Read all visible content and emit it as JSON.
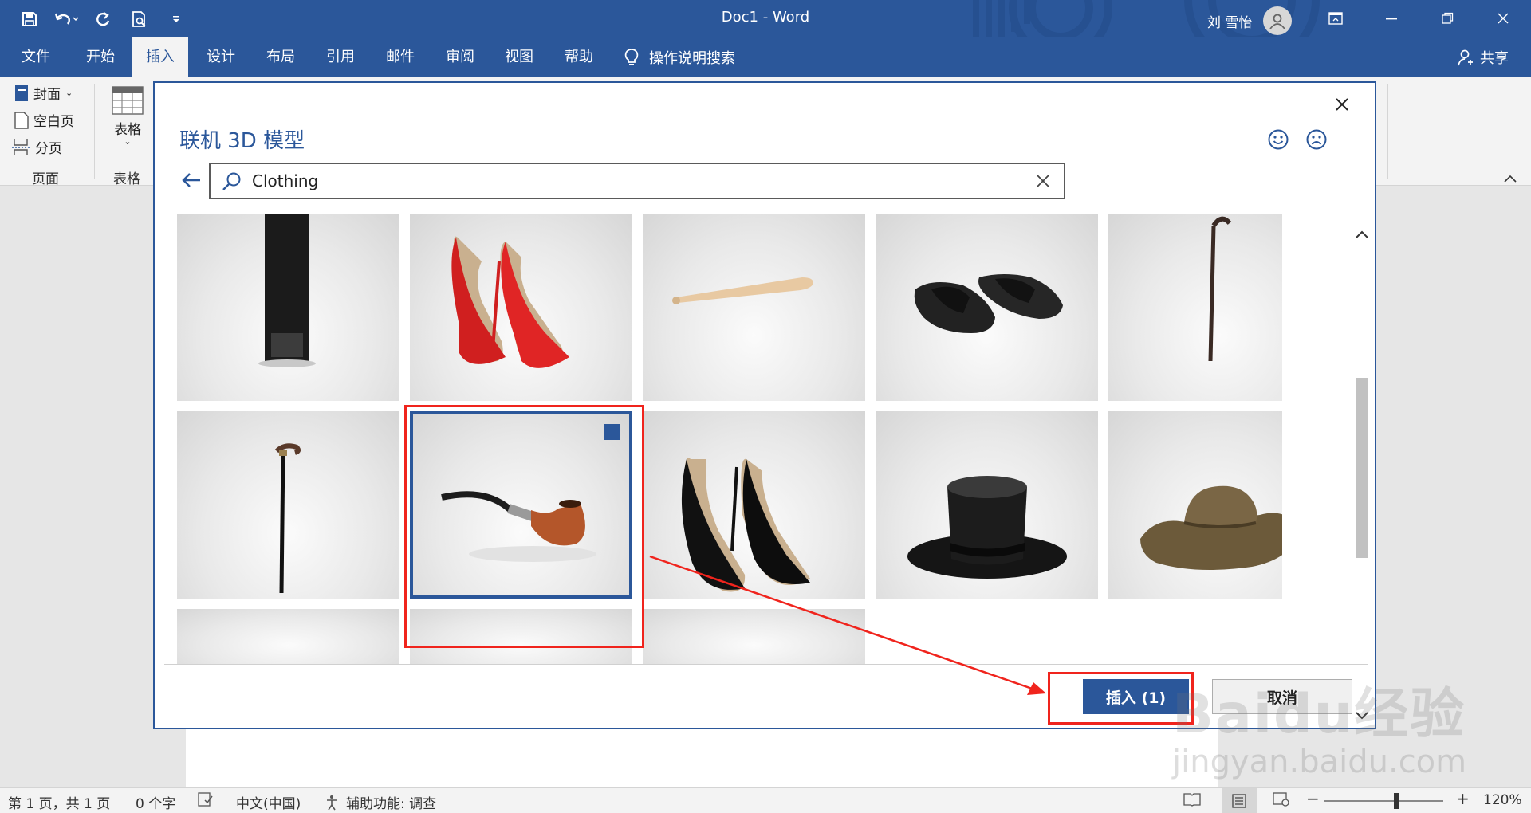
{
  "app": {
    "doc_title": "Doc1  -  Word",
    "user_name": "刘 雪怡",
    "qat": [
      "save-icon",
      "undo-icon",
      "redo-icon",
      "print-preview-icon",
      "customize-qat-icon"
    ]
  },
  "tabs": [
    "文件",
    "开始",
    "插入",
    "设计",
    "布局",
    "引用",
    "邮件",
    "审阅",
    "视图",
    "帮助"
  ],
  "active_tab": "插入",
  "tell_me": "操作说明搜索",
  "share": "共享",
  "ribbon": {
    "pages_group": {
      "cover": "封面",
      "blank": "空白页",
      "break": "分页",
      "label": "页面"
    },
    "table_group": {
      "table": "表格",
      "label": "表格"
    }
  },
  "dialog": {
    "title": "联机 3D 模型",
    "search_value": "Clothing",
    "insert_label": "插入 (1)",
    "cancel_label": "取消",
    "tiles": [
      {
        "model": "mirror"
      },
      {
        "model": "red-high-heels"
      },
      {
        "model": "baseball-bat"
      },
      {
        "model": "slippers"
      },
      {
        "model": "walking-cane"
      },
      {
        "model": "derby-cane"
      },
      {
        "model": "tobacco-pipe",
        "selected": true
      },
      {
        "model": "black-high-heels"
      },
      {
        "model": "top-hat"
      },
      {
        "model": "cowboy-hat"
      },
      {
        "model": "partial"
      },
      {
        "model": "partial"
      },
      {
        "model": "partial"
      }
    ]
  },
  "status": {
    "page": "第 1 页，共 1 页",
    "words": "0 个字",
    "lang": "中文(中国)",
    "accessibility": "辅助功能: 调查",
    "zoom": "120%"
  },
  "watermark": {
    "logo": "Baidu经验",
    "url": "jingyan.baidu.com"
  },
  "colors": {
    "word_blue": "#2b579a",
    "annotation_red": "#f0241d"
  }
}
